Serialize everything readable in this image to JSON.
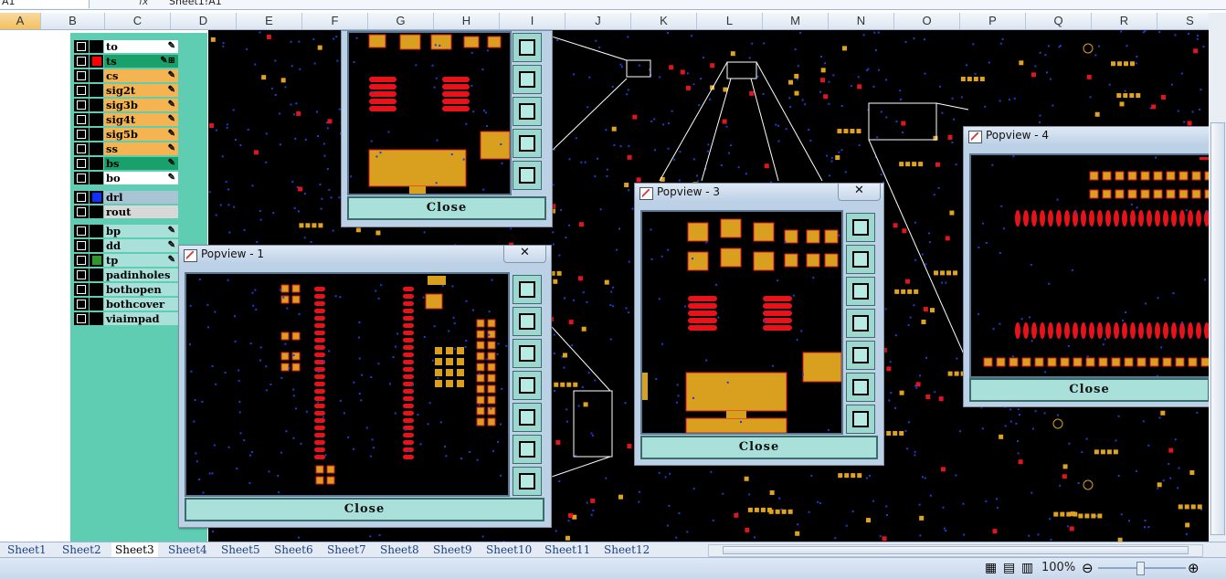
{
  "formula_bar": {
    "name_box": "A1",
    "fx": "fx",
    "formula": "Sheet1!A1"
  },
  "columns": [
    "A",
    "B",
    "C",
    "D",
    "E",
    "F",
    "G",
    "H",
    "I",
    "J",
    "K",
    "L",
    "M",
    "N",
    "O",
    "P",
    "Q",
    "R",
    "S"
  ],
  "layers": {
    "group1": [
      {
        "name": "to",
        "color": "#000000",
        "bg": "#ffffff",
        "pen": "✎"
      },
      {
        "name": "ts",
        "color": "#ff0000",
        "bg": "#1aa06a",
        "pen": "✎⊞"
      },
      {
        "name": "cs",
        "color": "#000000",
        "bg": "#f3b451",
        "pen": "✎"
      },
      {
        "name": "sig2t",
        "color": "#000000",
        "bg": "#f3b451",
        "pen": "✎"
      },
      {
        "name": "sig3b",
        "color": "#000000",
        "bg": "#f3b451",
        "pen": "✎"
      },
      {
        "name": "sig4t",
        "color": "#000000",
        "bg": "#f3b451",
        "pen": "✎"
      },
      {
        "name": "sig5b",
        "color": "#000000",
        "bg": "#f3b451",
        "pen": "✎"
      },
      {
        "name": "ss",
        "color": "#000000",
        "bg": "#f3b451",
        "pen": "✎"
      },
      {
        "name": "bs",
        "color": "#000000",
        "bg": "#1aa06a",
        "pen": "✎"
      },
      {
        "name": "bo",
        "color": "#000000",
        "bg": "#ffffff",
        "pen": "✎"
      }
    ],
    "group2": [
      {
        "name": "drl",
        "color": "#1030ff",
        "bg": "#a9c4d4",
        "pen": ""
      },
      {
        "name": "rout",
        "color": "#000000",
        "bg": "#d8d8d8",
        "pen": ""
      }
    ],
    "group3": [
      {
        "name": "bp",
        "color": "#000000",
        "bg": "#a9e0da",
        "pen": "✎"
      },
      {
        "name": "dd",
        "color": "#000000",
        "bg": "#a9e0da",
        "pen": "✎"
      },
      {
        "name": "tp",
        "color": "#2a9a2a",
        "bg": "#a9e0da",
        "pen": "✎"
      },
      {
        "name": "padinholes",
        "color": "#000000",
        "bg": "#a9e0da",
        "pen": ""
      },
      {
        "name": "bothopen",
        "color": "#000000",
        "bg": "#a9e0da",
        "pen": ""
      },
      {
        "name": "bothcover",
        "color": "#000000",
        "bg": "#a9e0da",
        "pen": ""
      },
      {
        "name": "viaimpad",
        "color": "#000000",
        "bg": "#a9e0da",
        "pen": ""
      }
    ]
  },
  "popups": [
    {
      "title": "Popview - 1",
      "close_x": "✕",
      "close_label": "Close"
    },
    {
      "title": "Popview - 3",
      "close_x": "✕",
      "close_label": "Close"
    },
    {
      "title": "Popview - 4",
      "close_x": "✕",
      "close_label": "Close"
    },
    {
      "title": "",
      "close_x": "",
      "close_label": "Close"
    }
  ],
  "sheet_tabs": [
    "Sheet1",
    "Sheet2",
    "Sheet3",
    "Sheet4",
    "Sheet5",
    "Sheet6",
    "Sheet7",
    "Sheet8",
    "Sheet9",
    "Sheet10",
    "Sheet11",
    "Sheet12"
  ],
  "active_sheet": "Sheet3",
  "status": {
    "zoom": "100%"
  },
  "icons": {
    "view-normal": "▦",
    "view-layout": "▤",
    "view-pagebreak": "▥",
    "zoom-out": "⊖",
    "zoom-in": "⊕"
  }
}
